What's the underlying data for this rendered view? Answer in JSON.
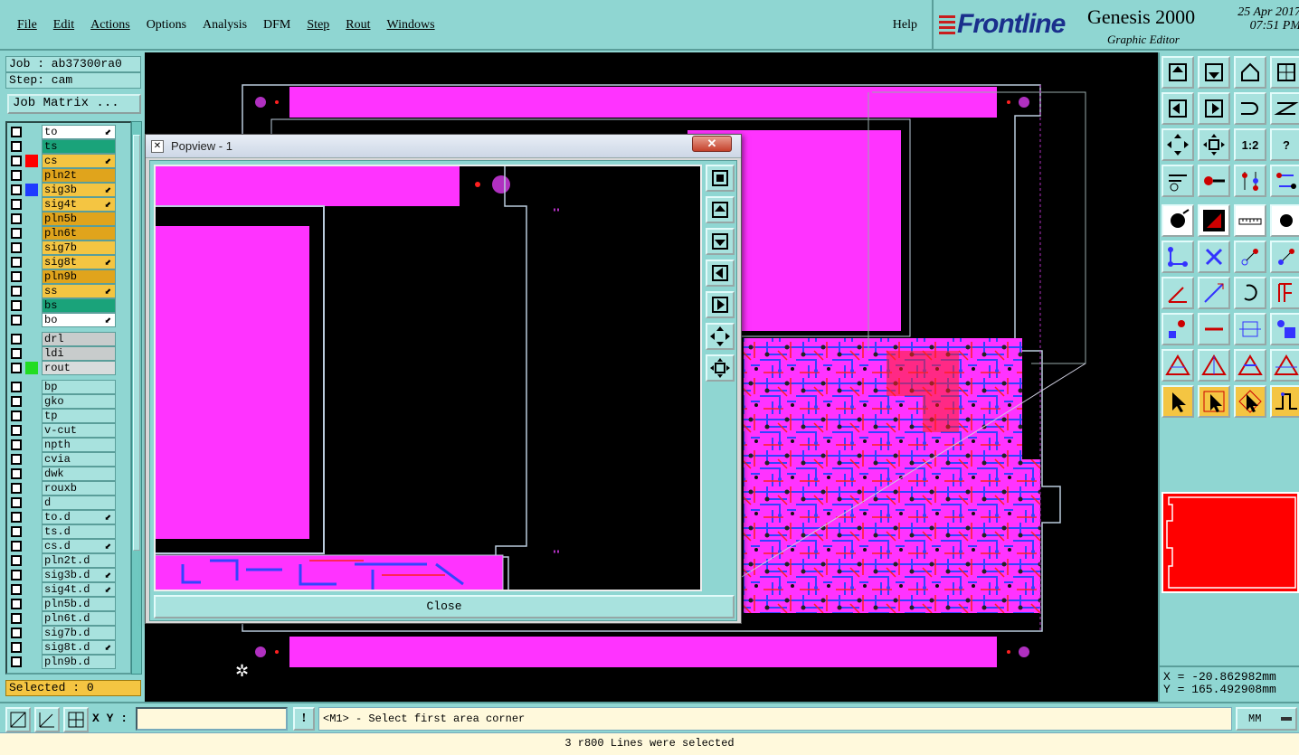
{
  "menu": {
    "items": [
      {
        "label": "File"
      },
      {
        "label": "Edit"
      },
      {
        "label": "Actions"
      },
      {
        "label": "Options"
      },
      {
        "label": "Analysis"
      },
      {
        "label": "DFM"
      },
      {
        "label": "Step"
      },
      {
        "label": "Rout"
      },
      {
        "label": "Windows"
      }
    ],
    "help": "Help"
  },
  "brand": {
    "logo": "Frontline",
    "product": "Genesis 2000",
    "subtitle": "Graphic Editor",
    "date": "25 Apr 2017",
    "time": "07:51 PM"
  },
  "job": {
    "job_line": "Job : ab37300ra0",
    "step_line": "Step: cam",
    "matrix_button": "Job Matrix ..."
  },
  "layers": [
    {
      "name": "to",
      "bg": "#ffffff",
      "swatch": "",
      "arrow": true
    },
    {
      "name": "ts",
      "bg": "#1aa37a",
      "swatch": "",
      "arrow": false
    },
    {
      "name": "cs",
      "bg": "#f4c542",
      "swatch": "#ff0000",
      "arrow": true
    },
    {
      "name": "pln2t",
      "bg": "#e0a41c",
      "swatch": "",
      "arrow": false
    },
    {
      "name": "sig3b",
      "bg": "#f4c542",
      "swatch": "#1e3cff",
      "arrow": true
    },
    {
      "name": "sig4t",
      "bg": "#f4c542",
      "swatch": "",
      "arrow": true
    },
    {
      "name": "pln5b",
      "bg": "#e0a41c",
      "swatch": "",
      "arrow": false
    },
    {
      "name": "pln6t",
      "bg": "#e0a41c",
      "swatch": "",
      "arrow": false
    },
    {
      "name": "sig7b",
      "bg": "#f4c542",
      "swatch": "",
      "arrow": false
    },
    {
      "name": "sig8t",
      "bg": "#f4c542",
      "swatch": "",
      "arrow": true
    },
    {
      "name": "pln9b",
      "bg": "#e0a41c",
      "swatch": "",
      "arrow": false
    },
    {
      "name": "ss",
      "bg": "#f4c542",
      "swatch": "",
      "arrow": true
    },
    {
      "name": "bs",
      "bg": "#1aa37a",
      "swatch": "",
      "arrow": false
    },
    {
      "name": "bo",
      "bg": "#ffffff",
      "swatch": "",
      "arrow": true
    }
  ],
  "drill_layers": [
    {
      "name": "drl",
      "bg": "#c8cccc",
      "swatch": ""
    },
    {
      "name": "ldi",
      "bg": "#c8cccc",
      "swatch": ""
    },
    {
      "name": "rout",
      "bg": "#d8dcdc",
      "swatch": "#22dd22"
    }
  ],
  "misc_layers": [
    {
      "name": "bp",
      "arrow": false
    },
    {
      "name": "gko",
      "arrow": false
    },
    {
      "name": "tp",
      "arrow": false
    },
    {
      "name": "v-cut",
      "arrow": false
    },
    {
      "name": "npth",
      "arrow": false
    },
    {
      "name": "cvia",
      "arrow": false
    },
    {
      "name": "dwk",
      "arrow": false
    },
    {
      "name": "rouxb",
      "arrow": false
    },
    {
      "name": "d",
      "arrow": false
    },
    {
      "name": "to.d",
      "arrow": true
    },
    {
      "name": "ts.d",
      "arrow": false
    },
    {
      "name": "cs.d",
      "arrow": true
    },
    {
      "name": "pln2t.d",
      "arrow": false
    },
    {
      "name": "sig3b.d",
      "arrow": true
    },
    {
      "name": "sig4t.d",
      "arrow": true
    },
    {
      "name": "pln5b.d",
      "arrow": false
    },
    {
      "name": "pln6t.d",
      "arrow": false
    },
    {
      "name": "sig7b.d",
      "arrow": false
    },
    {
      "name": "sig8t.d",
      "arrow": true
    },
    {
      "name": "pln9b.d",
      "arrow": false
    }
  ],
  "selected": "Selected : 0",
  "toolbar": {
    "rows": [
      [
        "zoom-home",
        "zoom-out",
        "home",
        "grid"
      ],
      [
        "pan-left",
        "pan-right",
        "swap",
        "snap"
      ],
      [
        "fit",
        "center",
        "1:2",
        "?"
      ],
      [
        "tools",
        "probe",
        "net-a",
        "net-b"
      ],
      [
        "pad-black",
        "fill-red",
        "ruler",
        "circle-black"
      ],
      [
        "connect",
        "cross",
        "line-a",
        "line-b"
      ],
      [
        "angle",
        "draw",
        "arc",
        "frame"
      ],
      [
        "feature",
        "edge",
        "measure",
        "group"
      ],
      [
        "tri-a",
        "tri-b",
        "tri-c",
        "tri-d"
      ],
      [
        "sel-a",
        "sel-b",
        "sel-c",
        "sel-d"
      ]
    ],
    "labels": {
      "1:2": "1:2",
      "?": "?"
    }
  },
  "coords": {
    "x": "X = -20.862982mm",
    "y": "Y = 165.492908mm"
  },
  "cmd": {
    "xy_label": "X Y :",
    "xy_value": "",
    "prompt": "<M1> - Select first area corner",
    "units": "MM"
  },
  "status": "3 r800 Lines were selected",
  "popview": {
    "title": "Popview - 1",
    "close_button": "Close"
  },
  "colors": {
    "magenta": "#ff33ff",
    "trace_blue": "#3344ff",
    "trace_red": "#ff2020",
    "background": "#8fd6d2"
  }
}
